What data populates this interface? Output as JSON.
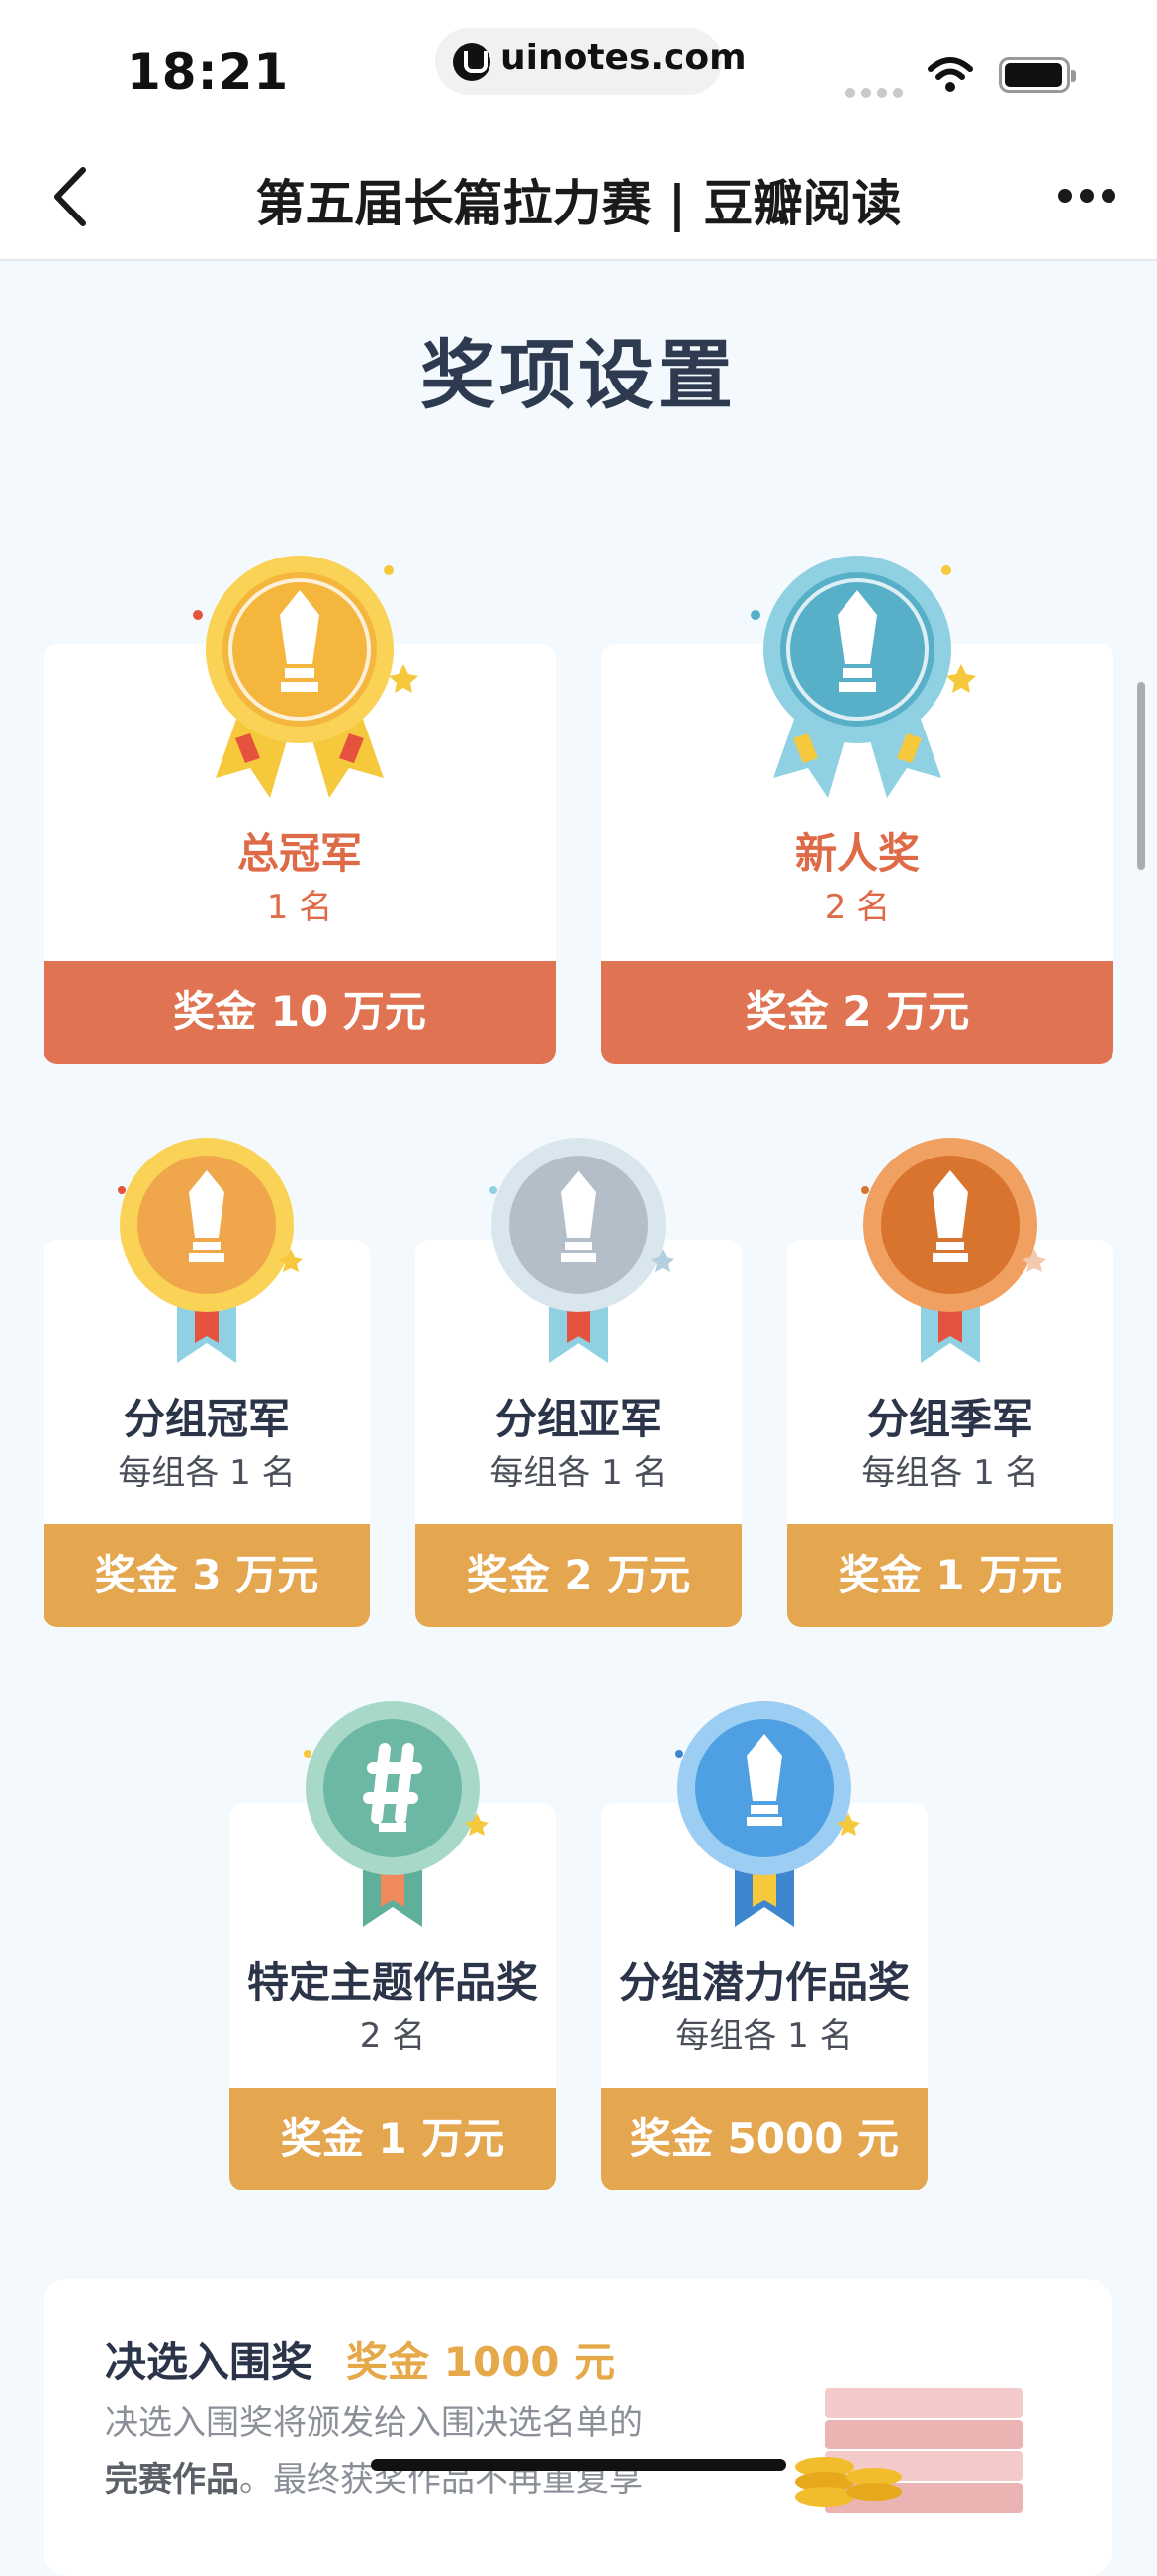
{
  "status": {
    "time": "18:21",
    "url": "uinotes.com"
  },
  "nav": {
    "title": "第五届长篇拉力赛 | 豆瓣阅读"
  },
  "section": {
    "title": "奖项设置"
  },
  "awards": [
    {
      "name": "总冠军",
      "count": "1 名",
      "prize": "奖金 10 万元"
    },
    {
      "name": "新人奖",
      "count": "2 名",
      "prize": "奖金 2 万元"
    },
    {
      "name": "分组冠军",
      "count": "每组各 1 名",
      "prize": "奖金 3 万元"
    },
    {
      "name": "分组亚军",
      "count": "每组各 1 名",
      "prize": "奖金 2 万元"
    },
    {
      "name": "分组季军",
      "count": "每组各 1 名",
      "prize": "奖金 1 万元"
    },
    {
      "name": "特定主题作品奖",
      "count": "2 名",
      "prize": "奖金 1 万元"
    },
    {
      "name": "分组潜力作品奖",
      "count": "每组各 1 名",
      "prize": "奖金 5000 元"
    }
  ],
  "finalist": {
    "title": "决选入围奖",
    "amount": "奖金 1000 元",
    "desc_line1": "决选入围奖将颁发给入围决选名单的",
    "desc_line2_bold": "完赛作品",
    "desc_line2_rest": "。最终获奖作品不再重复享"
  },
  "colors": {
    "background": "#f3f9fd",
    "red_prize": "#e07452",
    "orange_prize": "#e5a650",
    "gold_medal": "#f4b63d",
    "teal_medal": "#58b0c8",
    "silver_medal": "#b3bec8",
    "bronze_medal": "#d97a3a",
    "green_medal": "#6cb8a4",
    "blue_medal": "#4ea0e2"
  }
}
